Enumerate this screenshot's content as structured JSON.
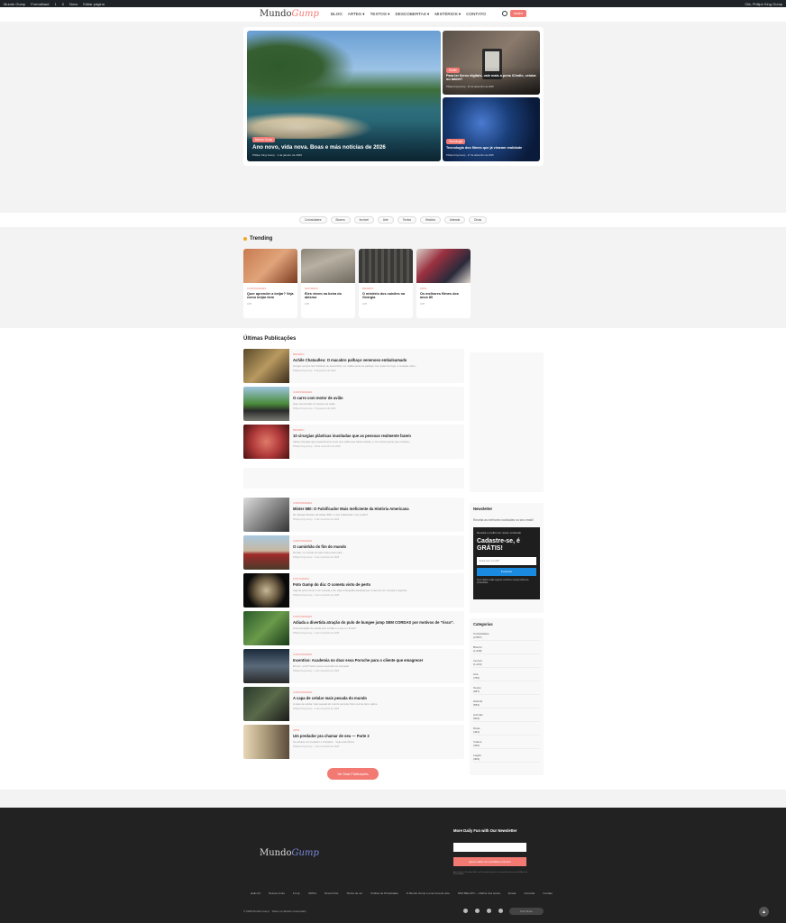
{
  "adminbar": {
    "items": [
      "Mundo Gump",
      "Formalhaut",
      "1",
      "0",
      "Novo",
      "Editar página"
    ],
    "user": "Olá, Philipe King Gump"
  },
  "header": {
    "logo_a": "Mundo",
    "logo_b": "Gump",
    "nav": [
      "BLOG",
      "ARTES ▾",
      "TEXTOS ▾",
      "DESCOBERTAS ▾",
      "MISTÉRIOS ▾",
      "CONTATO"
    ],
    "button": "Assine"
  },
  "hero": {
    "main": {
      "tag": "Mundo Gump",
      "title": "Ano novo, vida nova. Boas e más notícias de 2026",
      "meta": "Philipe King Gump · 1 de janeiro de 2026"
    },
    "side1": {
      "tag": "Kindle",
      "title": "Para ler livros digitais, vale mais a pena iCindle, celular ou tablet?",
      "meta": "Philipe King Gump · 31 de dezembro de 2025"
    },
    "side2": {
      "tag": "Tecnologia",
      "title": "Tecnologia dos filmes que já viraram realidade",
      "meta": "Philipe King Gump · 27 de dezembro de 2025"
    }
  },
  "chips": [
    "Curiosidades",
    "Bizarro",
    "Incrível",
    "Arte",
    "Textos",
    "História",
    "Animais",
    "Dicas"
  ],
  "trending": {
    "title": "Trending",
    "items": [
      {
        "cat": "CURIOSIDADES",
        "title": "Quer aprender a beijar? Veja como beijar bem",
        "meta": "4 ✉"
      },
      {
        "cat": "NATUREZA",
        "title": "Eles vivem na beira do abismo",
        "meta": "4 ✉"
      },
      {
        "cat": "BIZARRO",
        "title": "O mistério dos caixões na Geórgia",
        "meta": "4 ✉"
      },
      {
        "cat": "ARTE",
        "title": "Os melhores filmes dos anos 80",
        "meta": "4 ✉"
      }
    ]
  },
  "latest": {
    "title": "Últimas Publicações",
    "posts": [
      {
        "cat": "BIZARRO",
        "title": "Achile Chataulleu: O macabro palhaço venenoso embalsamado",
        "ex": "Amigos sempre têm histórias de assombrar, um malha verde de palhaço com poder de fogo, a verdade sobre...",
        "meta": "Philipe King Gump · 8 de janeiro de 2026"
      },
      {
        "cat": "CURIOSIDADES",
        "title": "O carro com motor de avião",
        "ex": "Hoje vamos falar um desses de avião...",
        "meta": "Philipe King Gump · 5 de janeiro de 2026"
      },
      {
        "cat": "BIZARRO",
        "title": "10 cirurgias plásticas inusitadas que as pessoas realmente fazem",
        "ex": "Várias cirurgias que possivelmente você nem sabia que havia existido, e nos vamos gente que conhece...",
        "meta": "Philipe King Gump · 28 de novembro de 2025"
      },
      {
        "cat": "CURIOSIDADES",
        "title": "Mister 880: O Falsificador Mais Ineficiente da História Americana",
        "ex": "Mr. Edward Mueller ele Mister 880, é você 'falsificador' nos couldn't",
        "meta": "Philipe King Gump · 3 de novembro de 2025"
      },
      {
        "cat": "CURIOSIDADES",
        "title": "O caminhão do fim do mundo",
        "ex": "De fato, no mundo do cara muito pesa mais...",
        "meta": "Philipe King Gump · 3 de novembro de 2025"
      },
      {
        "cat": "FOTOGRAFIA",
        "title": "Foto Gump do dia: O cometa visto de perto",
        "ex": "Veja de perto como é um cometa e ver veja a fotografia espacial que a nave de um cometa a registrar...",
        "meta": "Philipe King Gump · 3 de novembro de 2025"
      },
      {
        "cat": "CURIOSIDADES",
        "title": "Adiada a divertida atração do pulo de bungee jump SEM CORDAS por motivos de \"risco\".",
        "ex": "Uma sensação de queda sem cordas e o que é o limite?",
        "meta": "Philipe King Gump · 3 de novembro de 2025"
      },
      {
        "cat": "CURIOSIDADES",
        "title": "Incentivo: Academia no doar essa Porsche para o cliente que emagrecer",
        "ex": "Eh sim, você? Fazer pesos vencedor de campeão",
        "meta": "Philipe King Gump · 3 de novembro de 2025"
      },
      {
        "cat": "CURIOSIDADES",
        "title": "A capa de celular mais pesada do mundo",
        "ex": "A capa de celular mais pesada do mundo percebe ficar a tal de doze quilos...",
        "meta": "Philipe King Gump · 2 de novembro de 2025"
      },
      {
        "cat": "ARTE",
        "title": "Um predador pra chamar de seu — Parte 2",
        "ex": "Se achava um predador e Predador... Veja essa Ótima",
        "meta": "Philipe King Gump · 2 de novembro de 2025"
      }
    ],
    "more": "Ver Mais Publicações"
  },
  "sidebar": {
    "newsletter": {
      "title": "Newsletter",
      "text": "Receba as melhores novidades no seu email!",
      "box_kicker": "Receba o melhor do nosso conteúdo",
      "box_title": "Cadastre-se, é GRÁTIS!",
      "placeholder": "Insira seu e-mail*",
      "button": "Inscrever",
      "fine": "Seus dados estão seguros conforme nossa política de privacidade."
    },
    "categories": {
      "title": "Categorias",
      "items": [
        {
          "name": "Curiosidades",
          "count": "(2.807)"
        },
        {
          "name": "Bizarro",
          "count": "(1.648)"
        },
        {
          "name": "Incrível",
          "count": "(1.224)"
        },
        {
          "name": "Arte",
          "count": "(769)"
        },
        {
          "name": "Textos",
          "count": "(687)"
        },
        {
          "name": "História",
          "count": "(553)"
        },
        {
          "name": "Animais",
          "count": "(504)"
        },
        {
          "name": "Dicas",
          "count": "(491)"
        },
        {
          "name": "Vídeos",
          "count": "(463)"
        },
        {
          "name": "Legais",
          "count": "(403)"
        }
      ]
    }
  },
  "footer": {
    "logo_a": "Mundo",
    "logo_b": "Gump",
    "nl_title": "More Daily Fun with Our Newsletter",
    "nl_button": "Quero saber as novidades primeiro",
    "nl_fine": "Ao assinar o 'Fashion Gifts' você confirma que leu e concorda com nossa Política de Privacidade.",
    "links": [
      "Hello #1",
      "Nossos Links",
      "F.A.Q.",
      "DMCA",
      "Novos Post",
      "Textos de ver",
      "Política de Privacidade",
      "O Mundo Gump é uma zona de arte",
      "NÃO BELATO — Melhor dos textos",
      "Enviar",
      "Anunciar",
      "Contato"
    ],
    "copyright": "© 2026 Mundo Gump · Todos os direitos reservados",
    "darkmode": "Dark Mode"
  }
}
